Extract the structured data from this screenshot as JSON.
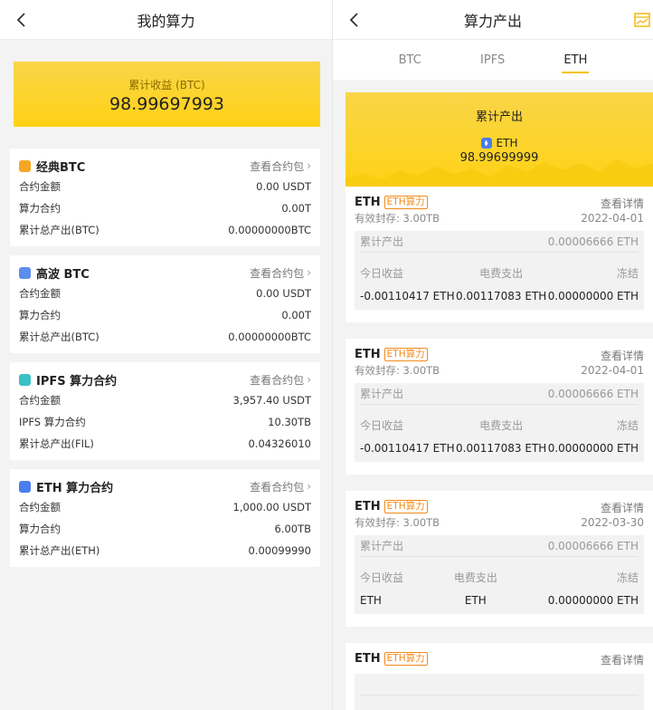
{
  "left": {
    "title": "我的算力",
    "total": {
      "label": "累计收益 (BTC)",
      "value": "98.99697993"
    },
    "contracts": [
      {
        "icon": "btc-icon",
        "icon_color": "#f5a623",
        "title": "经典BTC",
        "link": "查看合约包",
        "rows": [
          {
            "k": "合约金额",
            "v": "0.00 USDT"
          },
          {
            "k": "算力合约",
            "v": "0.00T"
          },
          {
            "k": "累计总产出(BTC)",
            "v": "0.00000000BTC"
          }
        ]
      },
      {
        "icon": "btc-icon",
        "icon_color": "#5b8def",
        "title": "高波 BTC",
        "link": "查看合约包",
        "rows": [
          {
            "k": "合约金额",
            "v": "0.00 USDT"
          },
          {
            "k": "算力合约",
            "v": "0.00T"
          },
          {
            "k": "累计总产出(BTC)",
            "v": "0.00000000BTC"
          }
        ]
      },
      {
        "icon": "ipfs-icon",
        "icon_color": "#3bc1c7",
        "title": "IPFS 算力合约",
        "link": "查看合约包",
        "rows": [
          {
            "k": "合约金额",
            "v": "3,957.40 USDT"
          },
          {
            "k": "IPFS 算力合约",
            "v": "10.30TB"
          },
          {
            "k": "累计总产出(FIL)",
            "v": "0.04326010"
          }
        ]
      },
      {
        "icon": "eth-icon",
        "icon_color": "#4a7df0",
        "title": "ETH 算力合约",
        "link": "查看合约包",
        "rows": [
          {
            "k": "合约金额",
            "v": "1,000.00 USDT"
          },
          {
            "k": "算力合约",
            "v": "6.00TB"
          },
          {
            "k": "累计总产出(ETH)",
            "v": "0.00099990"
          }
        ]
      }
    ]
  },
  "right": {
    "title": "算力产出",
    "tabs": [
      "BTC",
      "IPFS",
      "ETH"
    ],
    "active_tab": "ETH",
    "summary": {
      "label": "累计产出",
      "coin": "ETH",
      "value": "98.99699999"
    },
    "records": [
      {
        "name": "ETH",
        "tag": "ETH算力",
        "sub": "有效封存: 3.00TB",
        "link": "查看详情",
        "date": "2022-04-01",
        "acc_label": "累计产出",
        "acc_value": "0.00006666 ETH",
        "cols": [
          {
            "k": "今日收益",
            "v": "-0.00110417 ETH"
          },
          {
            "k": "电费支出",
            "v": "0.00117083 ETH"
          },
          {
            "k": "冻结",
            "v": "0.00000000 ETH"
          }
        ]
      },
      {
        "name": "ETH",
        "tag": "ETH算力",
        "sub": "有效封存: 3.00TB",
        "link": "查看详情",
        "date": "2022-04-01",
        "acc_label": "累计产出",
        "acc_value": "0.00006666 ETH",
        "cols": [
          {
            "k": "今日收益",
            "v": "-0.00110417 ETH"
          },
          {
            "k": "电费支出",
            "v": "0.00117083 ETH"
          },
          {
            "k": "冻结",
            "v": "0.00000000 ETH"
          }
        ]
      },
      {
        "name": "ETH",
        "tag": "ETH算力",
        "sub": "有效封存: 3.00TB",
        "link": "查看详情",
        "date": "2022-03-30",
        "acc_label": "累计产出",
        "acc_value": "0.00006666 ETH",
        "cols": [
          {
            "k": "今日收益",
            "v": "ETH"
          },
          {
            "k": "电费支出",
            "v": "ETH"
          },
          {
            "k": "冻结",
            "v": "0.00000000 ETH"
          }
        ]
      },
      {
        "name": "ETH",
        "tag": "ETH算力",
        "sub": "",
        "link": "查看详情",
        "date": "",
        "acc_label": "",
        "acc_value": "",
        "cols": [
          {
            "k": "",
            "v": ""
          },
          {
            "k": "",
            "v": ""
          },
          {
            "k": "",
            "v": ""
          }
        ]
      }
    ]
  }
}
